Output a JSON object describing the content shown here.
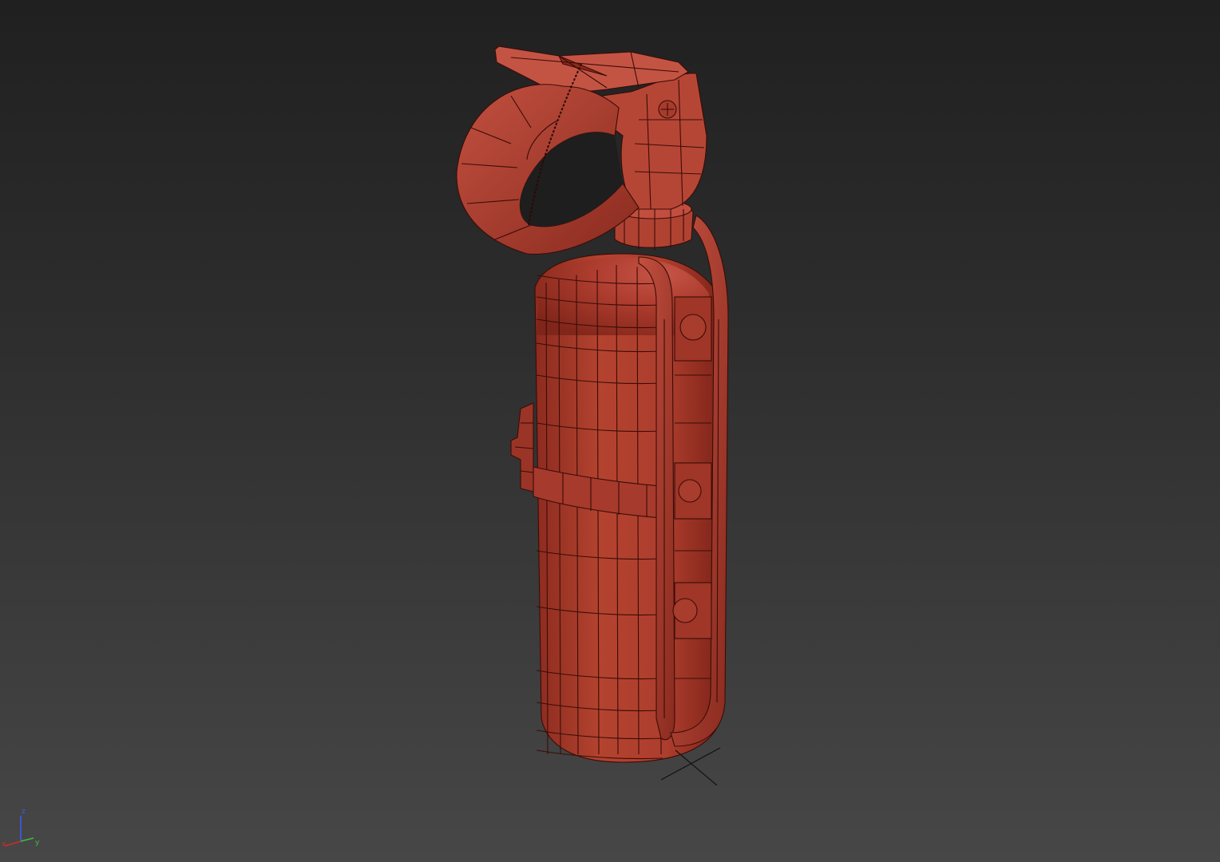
{
  "viewport": {
    "background_top": "#202020",
    "background_bottom": "#474747",
    "object_color": "#a93b2c",
    "wire_color": "#3a0c07",
    "object_name": ""
  },
  "axis_gizmo": {
    "x_label": "x",
    "y_label": "y",
    "z_label": "z",
    "x_color": "#d02a2a",
    "y_color": "#3cc03c",
    "z_color": "#3a5bff"
  },
  "pivot_marker": {
    "icon": "cross-icon",
    "color": "#111111"
  }
}
